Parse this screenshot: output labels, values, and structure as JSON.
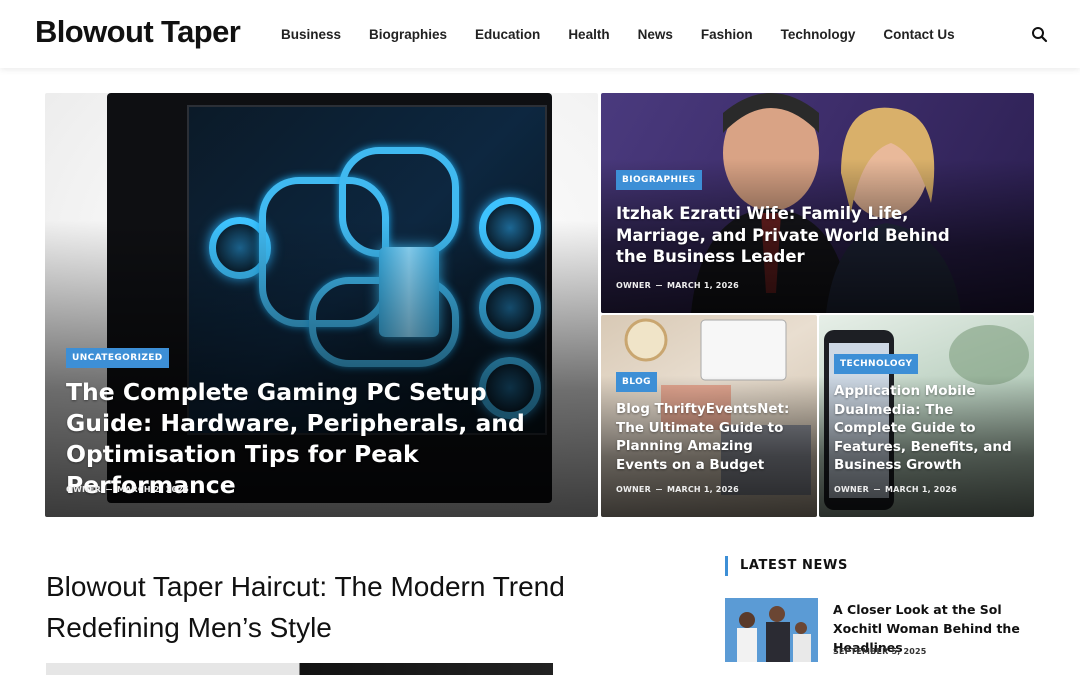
{
  "header": {
    "logo": "Blowout Taper",
    "nav": [
      "Business",
      "Biographies",
      "Education",
      "Health",
      "News",
      "Fashion",
      "Technology",
      "Contact Us"
    ],
    "search_icon": "search-icon"
  },
  "featured": {
    "main": {
      "category": "UNCATEGORIZED",
      "title": "The Complete Gaming PC Setup Guide: Hardware, Peripherals, and Optimisation Tips for Peak Performance",
      "author": "OWNER",
      "date": "MARCH 2, 2026"
    },
    "top": {
      "category": "BIOGRAPHIES",
      "title": "Itzhak Ezratti Wife: Family Life, Marriage, and Private World Behind the Business Leader",
      "author": "OWNER",
      "date": "MARCH 1, 2026"
    },
    "blog": {
      "category": "BLOG",
      "title": "Blog ThriftyEventsNet: The Ultimate Guide to Planning Amazing Events on a Budget",
      "author": "OWNER",
      "date": "MARCH 1, 2026"
    },
    "tech": {
      "category": "TECHNOLOGY",
      "title": "Application Mobile Dualmedia: The Complete Guide to Features, Benefits, and Business Growth",
      "author": "OWNER",
      "date": "MARCH 1, 2026"
    }
  },
  "article": {
    "title": "Blowout Taper Haircut: The Modern Trend Redefining Men’s Style"
  },
  "sidebar": {
    "heading": "LATEST NEWS",
    "items": [
      {
        "title": "A Closer Look at the Sol Xochitl Woman Behind the Headlines",
        "date": "SEPTEMBER 5, 2025"
      }
    ]
  },
  "colors": {
    "accent": "#3d8fd6"
  }
}
